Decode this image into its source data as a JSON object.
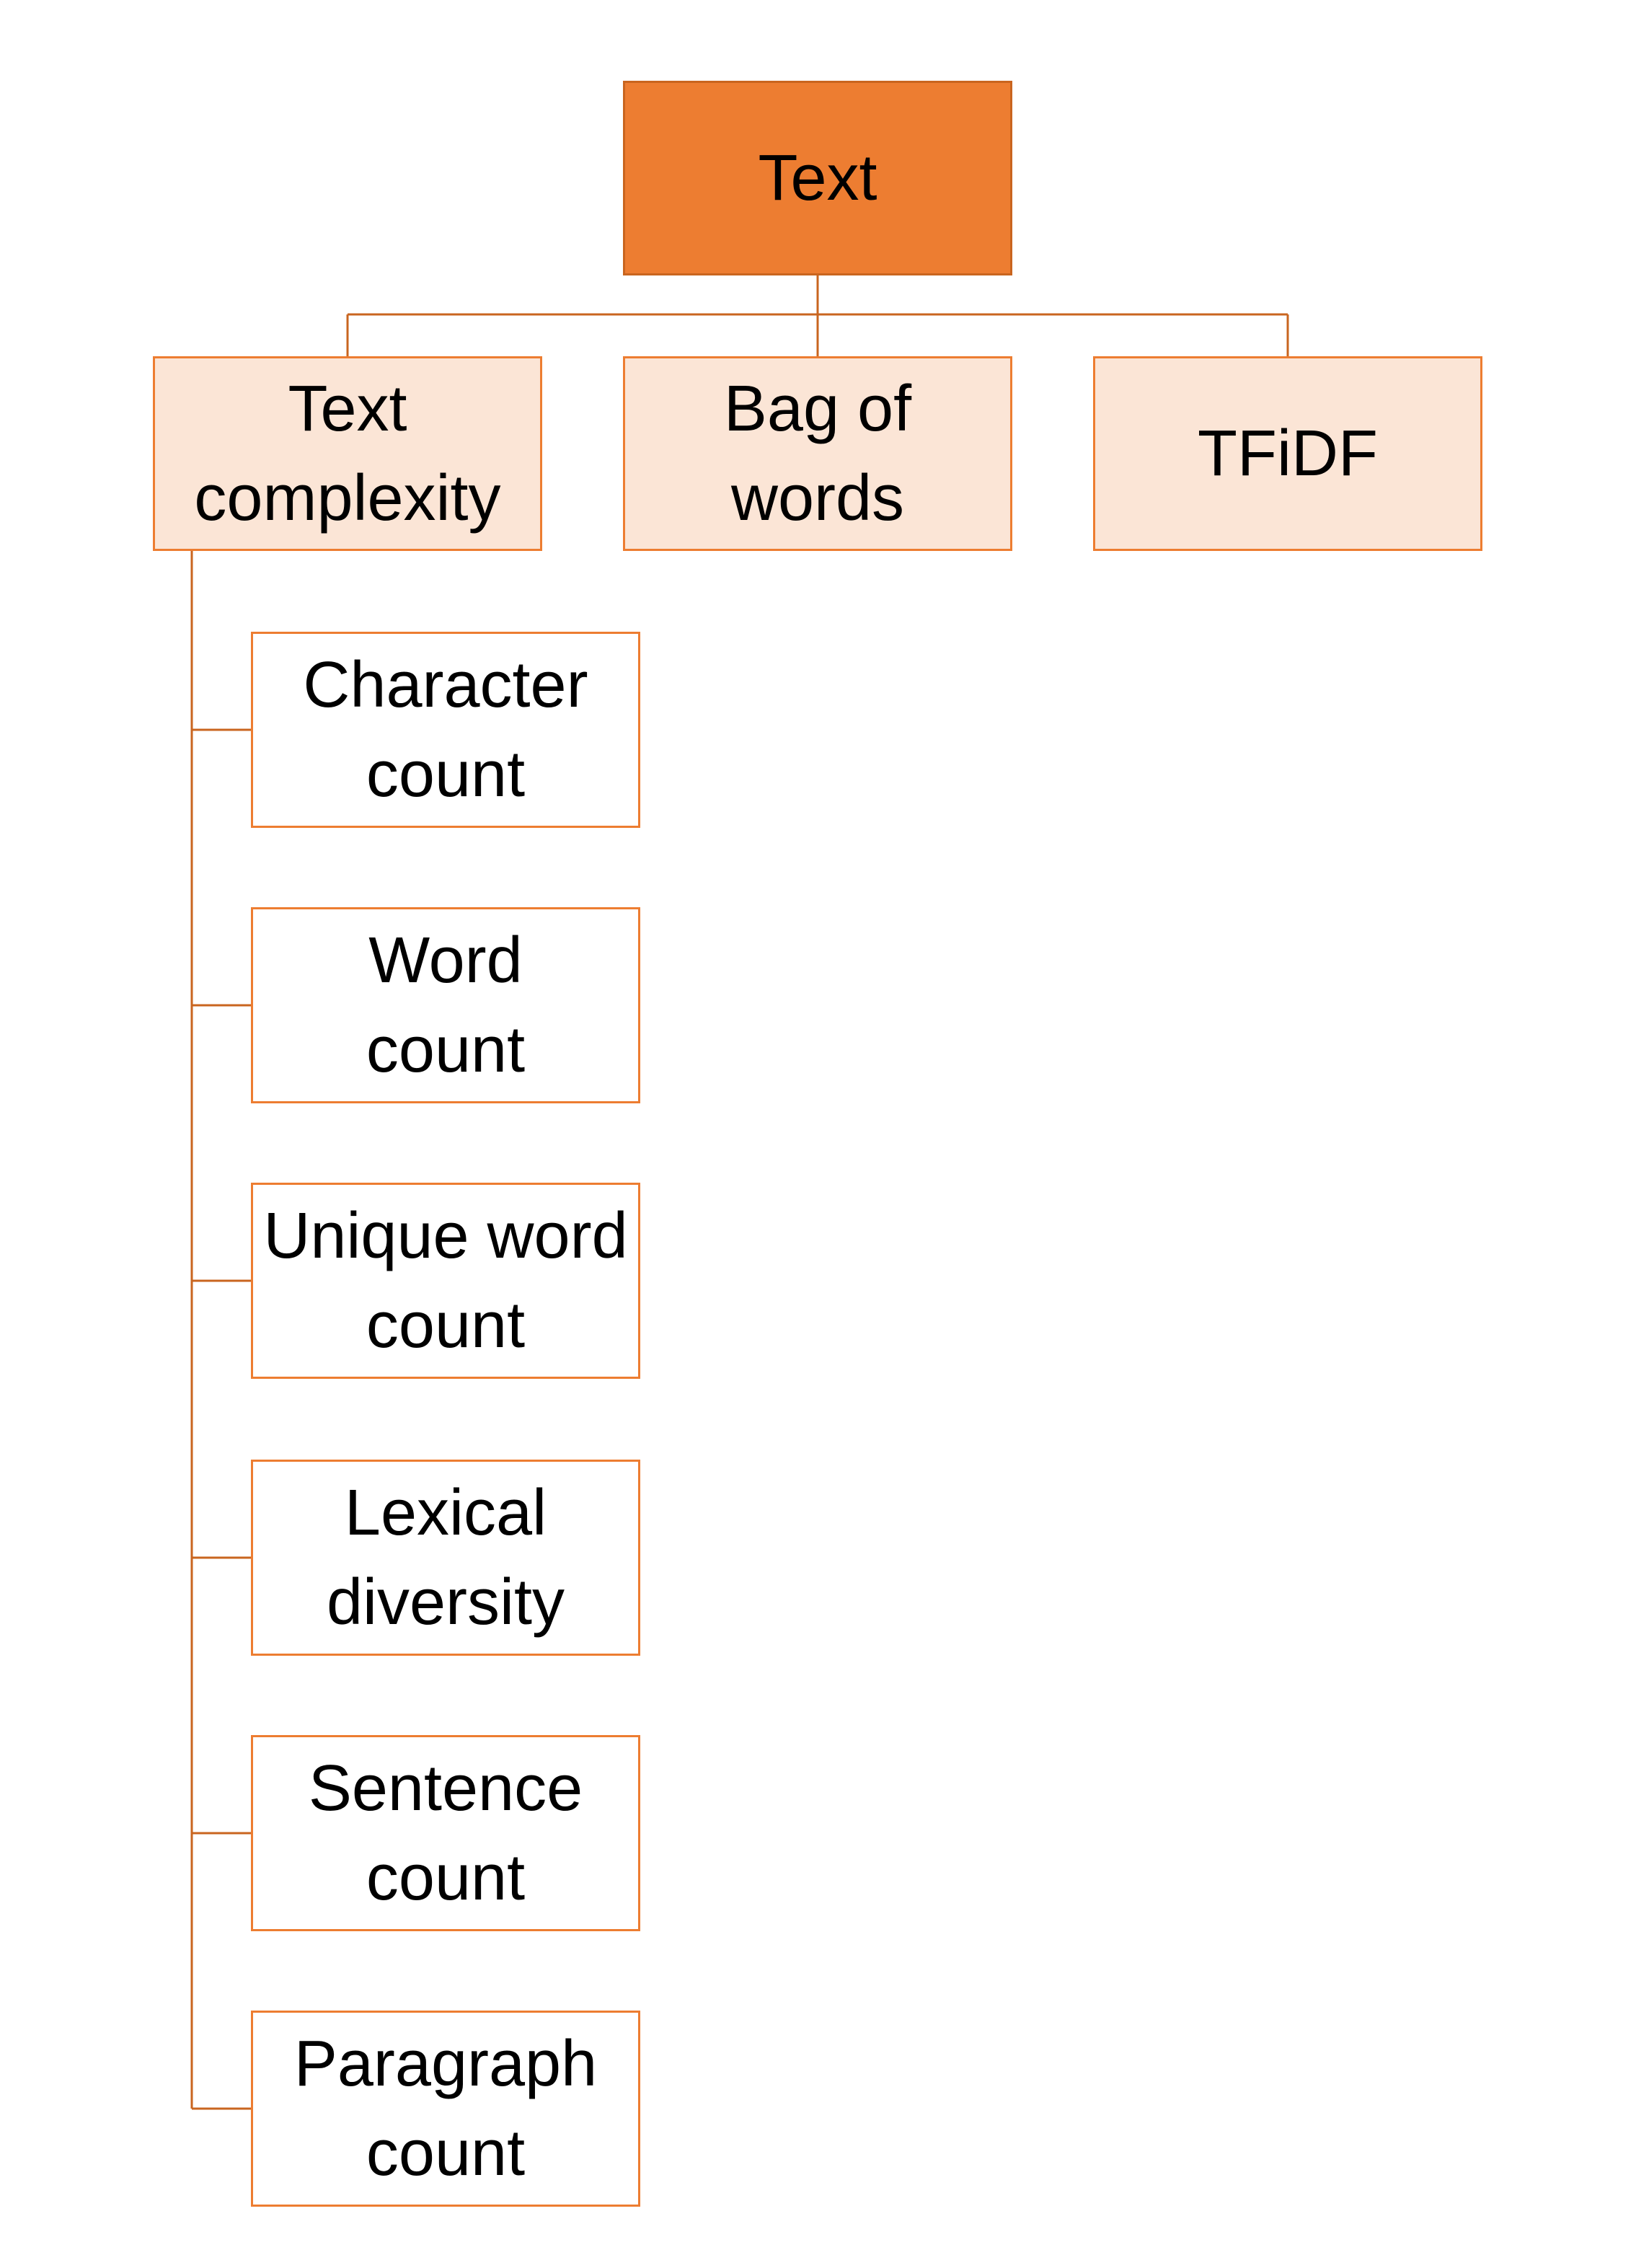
{
  "colors": {
    "root_fill": "#ED7D31",
    "category_fill": "#FBE5D6",
    "line": "#C9651F"
  },
  "root": {
    "label": "Text"
  },
  "categories": [
    {
      "label": "Text complexity"
    },
    {
      "label": "Bag of words"
    },
    {
      "label": "TFiDF"
    }
  ],
  "text_complexity_children": [
    {
      "label": "Character count"
    },
    {
      "label": "Word count"
    },
    {
      "label": "Unique word count"
    },
    {
      "label": "Lexical diversity"
    },
    {
      "label": "Sentence count"
    },
    {
      "label": "Paragraph count"
    }
  ]
}
